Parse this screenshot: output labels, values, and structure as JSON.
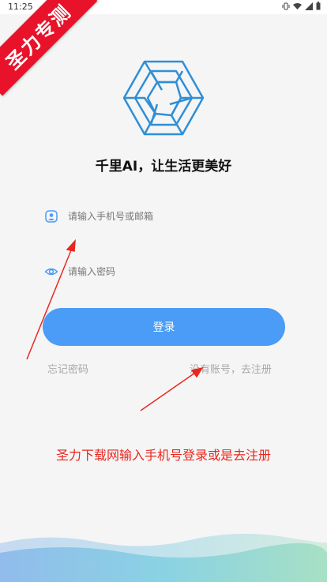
{
  "status_bar": {
    "time": "11:25",
    "icons": [
      "vibrate-icon",
      "wifi-icon",
      "signal-icon",
      "battery-icon"
    ]
  },
  "watermark": {
    "text": "圣力专测",
    "color": "#e8122a"
  },
  "logo": {
    "icon": "hexagon-logo-icon",
    "color": "#2f8fd6"
  },
  "slogan": "千里AI，让生活更美好",
  "form": {
    "phone": {
      "placeholder": "请输入手机号或邮箱",
      "value": "",
      "icon": "user-icon"
    },
    "password": {
      "placeholder": "请输入密码",
      "value": "",
      "icon": "eye-icon"
    },
    "login_label": "登录",
    "forgot_label": "忘记密码",
    "register_label": "没有账号，去注册"
  },
  "annotation": "圣力下载网输入手机号登录或是去注册",
  "colors": {
    "accent": "#4a9cf6",
    "annotation": "#e8281f",
    "background": "#f5f5f5"
  }
}
